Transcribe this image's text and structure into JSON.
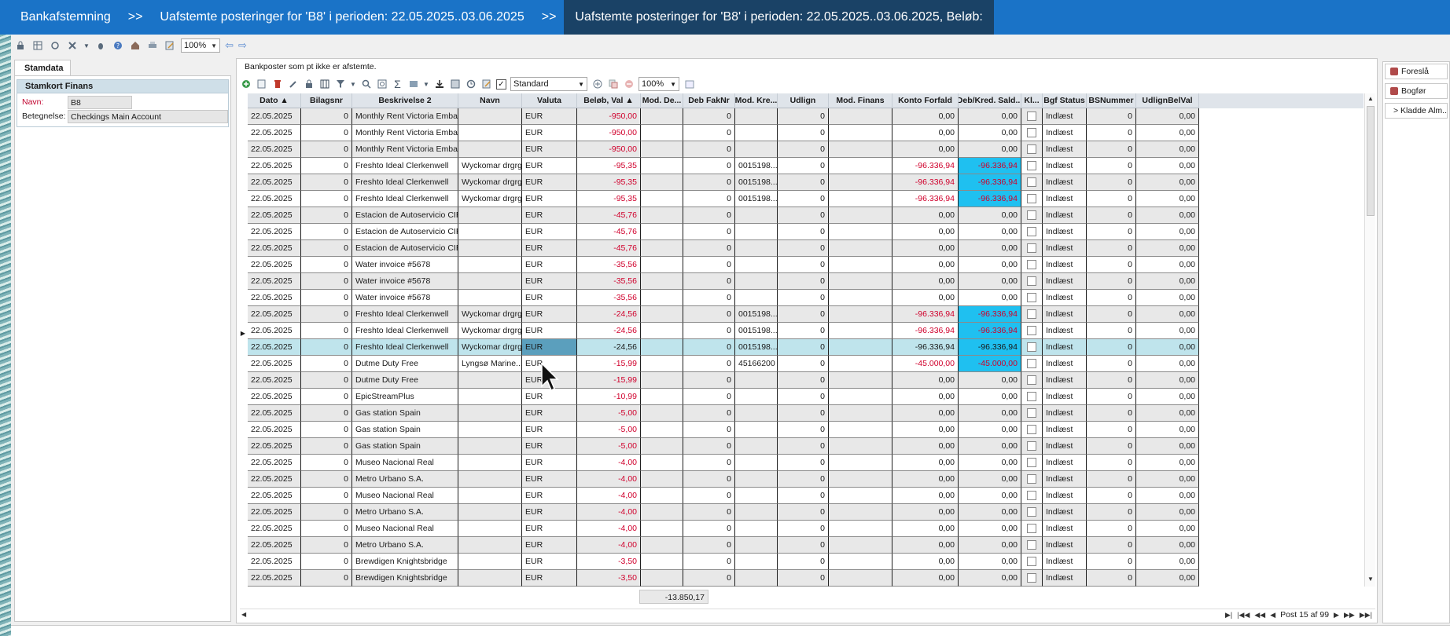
{
  "titlebar": {
    "crumbs": [
      "Bankafstemning",
      ">>",
      "Uafstemte posteringer for 'B8' i perioden: 22.05.2025..03.06.2025",
      ">>",
      "Uafstemte posteringer for 'B8' i perioden: 22.05.2025..03.06.2025, Beløb:"
    ]
  },
  "toolbar": {
    "zoom": "100%"
  },
  "left_panel": {
    "tab": "Stamdata",
    "section_title": "Stamkort Finans",
    "fields": [
      {
        "label": "Navn:",
        "value": "B8"
      },
      {
        "label": "Betegnelse:",
        "value": "Checkings Main Account"
      }
    ]
  },
  "main": {
    "title": "Bankposter som pt ikke er afstemte.",
    "layout_select": "Standard",
    "grid_zoom": "100%",
    "columns": [
      "Dato",
      "Bilagsnr",
      "Beskrivelse 2",
      "Navn",
      "Valuta",
      "Beløb, Val",
      "Mod. De...",
      "Deb FakNr",
      "Mod. Kre...",
      "Udlign",
      "Mod. Finans",
      "Konto Forfald",
      "Deb/Kred. Sald...",
      "Kl...",
      "Bgf Status",
      "BSNummer",
      "UdlignBelVal"
    ],
    "rows": [
      [
        "22.05.2025",
        "0",
        "Monthly Rent Victoria Emban...",
        "",
        "EUR",
        "-950,00",
        "",
        "0",
        "",
        "0",
        "",
        "0,00",
        "0,00",
        "",
        "Indlæst",
        "0",
        "0,00"
      ],
      [
        "22.05.2025",
        "0",
        "Monthly Rent Victoria Emban...",
        "",
        "EUR",
        "-950,00",
        "",
        "0",
        "",
        "0",
        "",
        "0,00",
        "0,00",
        "",
        "Indlæst",
        "0",
        "0,00"
      ],
      [
        "22.05.2025",
        "0",
        "Monthly Rent Victoria Emban...",
        "",
        "EUR",
        "-950,00",
        "",
        "0",
        "",
        "0",
        "",
        "0,00",
        "0,00",
        "",
        "Indlæst",
        "0",
        "0,00"
      ],
      [
        "22.05.2025",
        "0",
        "Freshto Ideal Clerkenwell",
        "Wyckomar drgrg",
        "EUR",
        "-95,35",
        "",
        "0",
        "0015198...",
        "0",
        "",
        "-96.336,94",
        "-96.336,94",
        "",
        "Indlæst",
        "0",
        "0,00"
      ],
      [
        "22.05.2025",
        "0",
        "Freshto Ideal Clerkenwell",
        "Wyckomar drgrg",
        "EUR",
        "-95,35",
        "",
        "0",
        "0015198...",
        "0",
        "",
        "-96.336,94",
        "-96.336,94",
        "",
        "Indlæst",
        "0",
        "0,00"
      ],
      [
        "22.05.2025",
        "0",
        "Freshto Ideal Clerkenwell",
        "Wyckomar drgrg",
        "EUR",
        "-95,35",
        "",
        "0",
        "0015198...",
        "0",
        "",
        "-96.336,94",
        "-96.336,94",
        "",
        "Indlæst",
        "0",
        "0,00"
      ],
      [
        "22.05.2025",
        "0",
        "Estacion de Autoservicio CIRI...",
        "",
        "EUR",
        "-45,76",
        "",
        "0",
        "",
        "0",
        "",
        "0,00",
        "0,00",
        "",
        "Indlæst",
        "0",
        "0,00"
      ],
      [
        "22.05.2025",
        "0",
        "Estacion de Autoservicio CIRI...",
        "",
        "EUR",
        "-45,76",
        "",
        "0",
        "",
        "0",
        "",
        "0,00",
        "0,00",
        "",
        "Indlæst",
        "0",
        "0,00"
      ],
      [
        "22.05.2025",
        "0",
        "Estacion de Autoservicio CIRI...",
        "",
        "EUR",
        "-45,76",
        "",
        "0",
        "",
        "0",
        "",
        "0,00",
        "0,00",
        "",
        "Indlæst",
        "0",
        "0,00"
      ],
      [
        "22.05.2025",
        "0",
        "Water invoice #5678",
        "",
        "EUR",
        "-35,56",
        "",
        "0",
        "",
        "0",
        "",
        "0,00",
        "0,00",
        "",
        "Indlæst",
        "0",
        "0,00"
      ],
      [
        "22.05.2025",
        "0",
        "Water invoice #5678",
        "",
        "EUR",
        "-35,56",
        "",
        "0",
        "",
        "0",
        "",
        "0,00",
        "0,00",
        "",
        "Indlæst",
        "0",
        "0,00"
      ],
      [
        "22.05.2025",
        "0",
        "Water invoice #5678",
        "",
        "EUR",
        "-35,56",
        "",
        "0",
        "",
        "0",
        "",
        "0,00",
        "0,00",
        "",
        "Indlæst",
        "0",
        "0,00"
      ],
      [
        "22.05.2025",
        "0",
        "Freshto Ideal Clerkenwell",
        "Wyckomar drgrg",
        "EUR",
        "-24,56",
        "",
        "0",
        "0015198...",
        "0",
        "",
        "-96.336,94",
        "-96.336,94",
        "",
        "Indlæst",
        "0",
        "0,00"
      ],
      [
        "22.05.2025",
        "0",
        "Freshto Ideal Clerkenwell",
        "Wyckomar drgrg",
        "EUR",
        "-24,56",
        "",
        "0",
        "0015198...",
        "0",
        "",
        "-96.336,94",
        "-96.336,94",
        "",
        "Indlæst",
        "0",
        "0,00"
      ],
      [
        "22.05.2025",
        "0",
        "Freshto Ideal Clerkenwell",
        "Wyckomar drgrg",
        "EUR",
        "-24,56",
        "",
        "0",
        "0015198...",
        "0",
        "",
        "-96.336,94",
        "-96.336,94",
        "",
        "Indlæst",
        "0",
        "0,00"
      ],
      [
        "22.05.2025",
        "0",
        "Dutme Duty Free",
        "Lyngsø Marine...",
        "EUR",
        "-15,99",
        "",
        "0",
        "45166200",
        "0",
        "",
        "-45.000,00",
        "-45.000,00",
        "",
        "Indlæst",
        "0",
        "0,00"
      ],
      [
        "22.05.2025",
        "0",
        "Dutme Duty Free",
        "",
        "EUR",
        "-15,99",
        "",
        "0",
        "",
        "0",
        "",
        "0,00",
        "0,00",
        "",
        "Indlæst",
        "0",
        "0,00"
      ],
      [
        "22.05.2025",
        "0",
        "EpicStreamPlus",
        "",
        "EUR",
        "-10,99",
        "",
        "0",
        "",
        "0",
        "",
        "0,00",
        "0,00",
        "",
        "Indlæst",
        "0",
        "0,00"
      ],
      [
        "22.05.2025",
        "0",
        "Gas station Spain",
        "",
        "EUR",
        "-5,00",
        "",
        "0",
        "",
        "0",
        "",
        "0,00",
        "0,00",
        "",
        "Indlæst",
        "0",
        "0,00"
      ],
      [
        "22.05.2025",
        "0",
        "Gas station Spain",
        "",
        "EUR",
        "-5,00",
        "",
        "0",
        "",
        "0",
        "",
        "0,00",
        "0,00",
        "",
        "Indlæst",
        "0",
        "0,00"
      ],
      [
        "22.05.2025",
        "0",
        "Gas station Spain",
        "",
        "EUR",
        "-5,00",
        "",
        "0",
        "",
        "0",
        "",
        "0,00",
        "0,00",
        "",
        "Indlæst",
        "0",
        "0,00"
      ],
      [
        "22.05.2025",
        "0",
        "Museo Nacional Real",
        "",
        "EUR",
        "-4,00",
        "",
        "0",
        "",
        "0",
        "",
        "0,00",
        "0,00",
        "",
        "Indlæst",
        "0",
        "0,00"
      ],
      [
        "22.05.2025",
        "0",
        "Metro Urbano S.A.",
        "",
        "EUR",
        "-4,00",
        "",
        "0",
        "",
        "0",
        "",
        "0,00",
        "0,00",
        "",
        "Indlæst",
        "0",
        "0,00"
      ],
      [
        "22.05.2025",
        "0",
        "Museo Nacional Real",
        "",
        "EUR",
        "-4,00",
        "",
        "0",
        "",
        "0",
        "",
        "0,00",
        "0,00",
        "",
        "Indlæst",
        "0",
        "0,00"
      ],
      [
        "22.05.2025",
        "0",
        "Metro Urbano S.A.",
        "",
        "EUR",
        "-4,00",
        "",
        "0",
        "",
        "0",
        "",
        "0,00",
        "0,00",
        "",
        "Indlæst",
        "0",
        "0,00"
      ],
      [
        "22.05.2025",
        "0",
        "Museo Nacional Real",
        "",
        "EUR",
        "-4,00",
        "",
        "0",
        "",
        "0",
        "",
        "0,00",
        "0,00",
        "",
        "Indlæst",
        "0",
        "0,00"
      ],
      [
        "22.05.2025",
        "0",
        "Metro Urbano S.A.",
        "",
        "EUR",
        "-4,00",
        "",
        "0",
        "",
        "0",
        "",
        "0,00",
        "0,00",
        "",
        "Indlæst",
        "0",
        "0,00"
      ],
      [
        "22.05.2025",
        "0",
        "Brewdigen Knightsbridge",
        "",
        "EUR",
        "-3,50",
        "",
        "0",
        "",
        "0",
        "",
        "0,00",
        "0,00",
        "",
        "Indlæst",
        "0",
        "0,00"
      ],
      [
        "22.05.2025",
        "0",
        "Brewdigen Knightsbridge",
        "",
        "EUR",
        "-3,50",
        "",
        "0",
        "",
        "0",
        "",
        "0,00",
        "0,00",
        "",
        "Indlæst",
        "0",
        "0,00"
      ]
    ],
    "selected_row_index": 14,
    "sum_value": "-13.850,17",
    "pager": "Post 15 af 99"
  },
  "right_panel": {
    "buttons": [
      "Foreslå",
      "Bogfør",
      "> Kladde Alm..."
    ]
  },
  "colors": {
    "titlebar": "#1a73c7",
    "titlebar_active": "#1a4266",
    "negative": "#d0002c",
    "highlight": "#1fc0f0",
    "selected_row": "#bfe4ec"
  }
}
